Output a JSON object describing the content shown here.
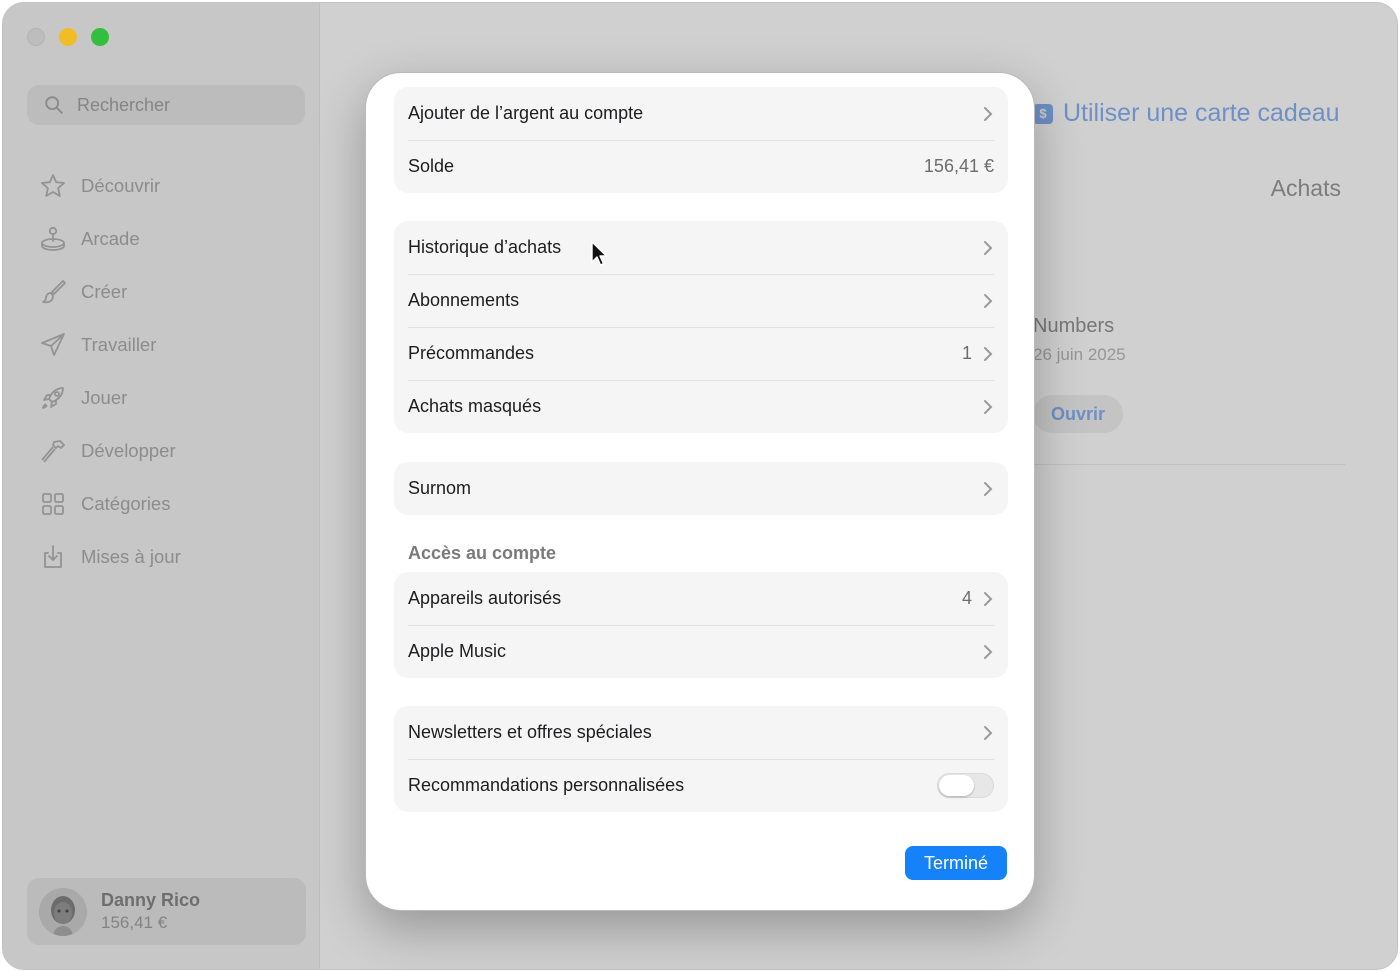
{
  "sidebar": {
    "search_placeholder": "Rechercher",
    "items": [
      {
        "label": "Découvrir",
        "icon": "star-icon"
      },
      {
        "label": "Arcade",
        "icon": "joystick-icon"
      },
      {
        "label": "Créer",
        "icon": "brush-icon"
      },
      {
        "label": "Travailler",
        "icon": "paperplane-icon"
      },
      {
        "label": "Jouer",
        "icon": "rocket-icon"
      },
      {
        "label": "Développer",
        "icon": "hammer-icon"
      },
      {
        "label": "Catégories",
        "icon": "grid-icon"
      },
      {
        "label": "Mises à jour",
        "icon": "download-icon"
      }
    ],
    "account": {
      "name": "Danny Rico",
      "balance": "156,41 €"
    }
  },
  "background": {
    "gift_card_link": "Utiliser une carte cadeau",
    "purchases_title": "Achats",
    "app_name": "Numbers",
    "app_date": "26 juin 2025",
    "open_button": "Ouvrir"
  },
  "modal": {
    "groups": [
      {
        "rows": [
          {
            "label": "Ajouter de l’argent au compte"
          },
          {
            "label": "Solde",
            "value": "156,41 €"
          }
        ]
      },
      {
        "rows": [
          {
            "label": "Historique d’achats"
          },
          {
            "label": "Abonnements"
          },
          {
            "label": "Précommandes",
            "value": "1"
          },
          {
            "label": "Achats masqués"
          }
        ]
      },
      {
        "rows": [
          {
            "label": "Surnom"
          }
        ]
      },
      {
        "rows": [
          {
            "label": "Appareils autorisés",
            "value": "4"
          },
          {
            "label": "Apple Music"
          }
        ]
      },
      {
        "rows": [
          {
            "label": "Newsletters et offres spéciales"
          },
          {
            "label": "Recommandations personnalisées"
          }
        ]
      }
    ],
    "section_account_access": "Accès au compte",
    "done_button": "Terminé"
  },
  "colors": {
    "accent_blue": "#1582f9",
    "dimmed_link_blue": "#6e90c6",
    "close_dot": "#bdbdbd",
    "minimize_dot": "#f2bc27",
    "maximize_dot": "#33bf3e"
  }
}
